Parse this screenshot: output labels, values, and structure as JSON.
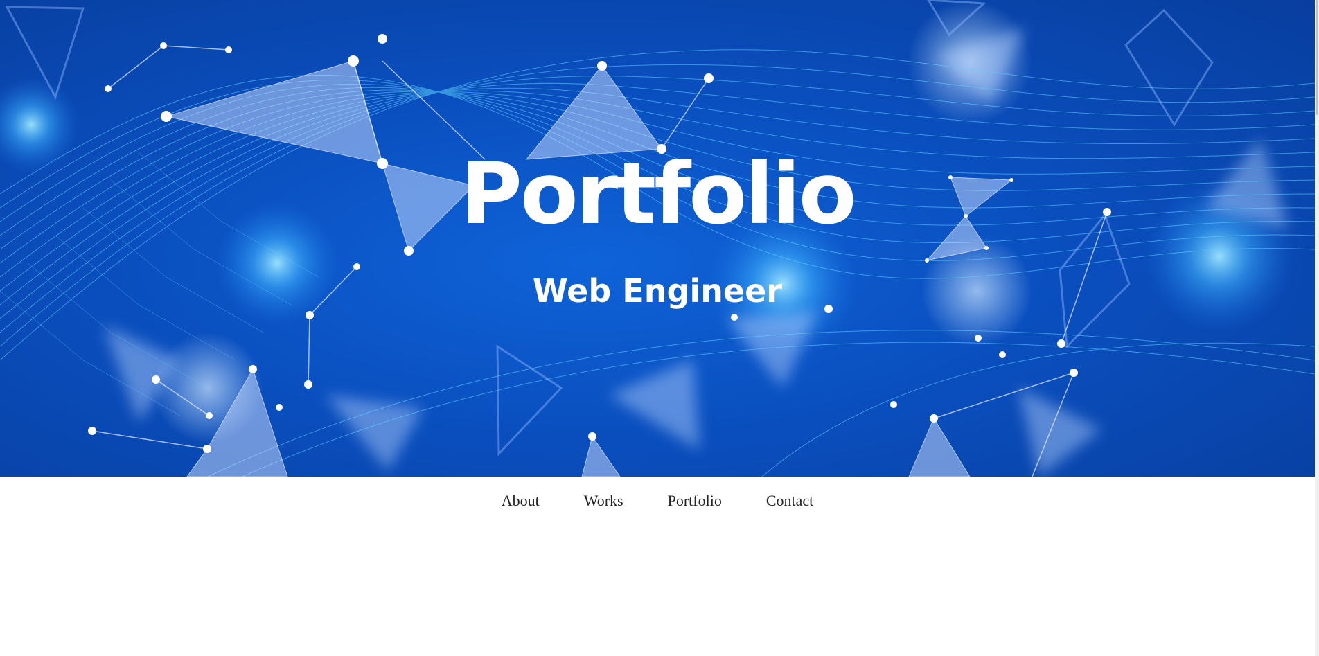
{
  "hero": {
    "title": "Portfolio",
    "subtitle": "Web Engineer",
    "background_image": "blue-network-polygon-background"
  },
  "nav": {
    "items": [
      {
        "label": "About"
      },
      {
        "label": "Works"
      },
      {
        "label": "Portfolio"
      },
      {
        "label": "Contact"
      }
    ]
  },
  "colors": {
    "hero_blue": "#0a4fbf",
    "hero_text": "#ffffff",
    "nav_text": "#222222",
    "page_background": "#ffffff"
  }
}
